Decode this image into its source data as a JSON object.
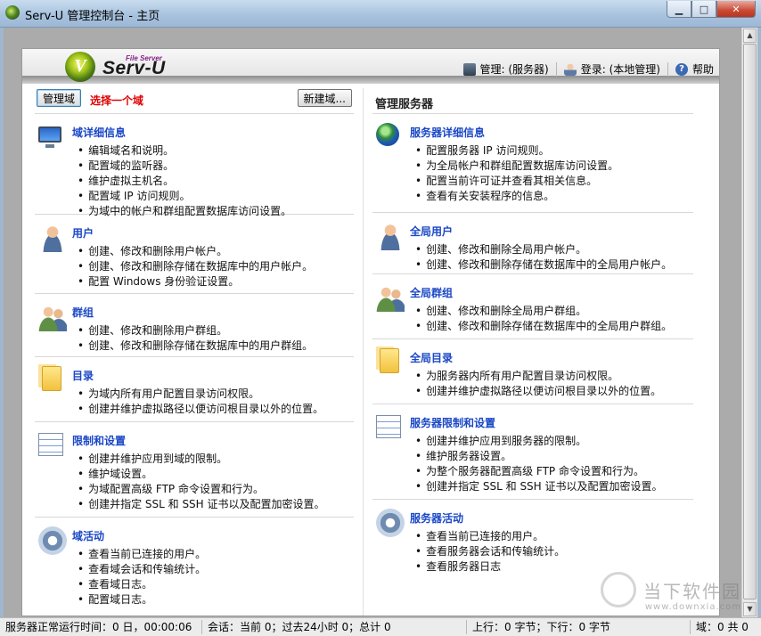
{
  "window": {
    "title": "Serv-U 管理控制台 - 主页",
    "buttons": {
      "minimize": "▁",
      "maximize": "□",
      "close": "✕"
    }
  },
  "banner": {
    "logo_text": "Serv-U",
    "logo_subtitle": "File Server",
    "logo_mark": "V",
    "links": {
      "manage": "管理: (服务器)",
      "login": "登录: (本地管理)",
      "help": "帮助"
    },
    "icons": [
      "server-icon",
      "user-icon",
      "help-icon"
    ]
  },
  "left": {
    "domain_button": "管理域",
    "select_hint": "选择一个域",
    "new_domain_button": "新建域...",
    "sections": [
      {
        "icon": "monitor-icon",
        "title": "域详细信息",
        "items": [
          "编辑域名和说明。",
          "配置域的监听器。",
          "维护虚拟主机名。",
          "配置域 IP 访问规则。",
          "为域中的帐户和群组配置数据库访问设置。"
        ]
      },
      {
        "icon": "user-icon",
        "title": "用户",
        "items": [
          "创建、修改和删除用户帐户。",
          "创建、修改和删除存储在数据库中的用户帐户。",
          "配置 Windows 身份验证设置。"
        ]
      },
      {
        "icon": "group-icon",
        "title": "群组",
        "items": [
          "创建、修改和删除用户群组。",
          "创建、修改和删除存储在数据库中的用户群组。"
        ]
      },
      {
        "icon": "folder-icon",
        "title": "目录",
        "items": [
          "为域内所有用户配置目录访问权限。",
          "创建并维护虚拟路径以便访问根目录以外的位置。"
        ]
      },
      {
        "icon": "checklist-icon",
        "title": "限制和设置",
        "items": [
          "创建并维护应用到域的限制。",
          "维护域设置。",
          "为域配置高级 FTP 命令设置和行为。",
          "创建并指定 SSL 和 SSH 证书以及配置加密设置。"
        ]
      },
      {
        "icon": "gear-icon",
        "title": "域活动",
        "items": [
          "查看当前已连接的用户。",
          "查看域会话和传输统计。",
          "查看域日志。",
          "配置域日志。"
        ]
      }
    ]
  },
  "right": {
    "heading": "管理服务器",
    "sections": [
      {
        "icon": "globe-icon",
        "title": "服务器详细信息",
        "items": [
          "配置服务器 IP 访问规则。",
          "为全局帐户和群组配置数据库访问设置。",
          "配置当前许可证并查看其相关信息。",
          "查看有关安装程序的信息。"
        ]
      },
      {
        "icon": "user-icon",
        "title": "全局用户",
        "items": [
          "创建、修改和删除全局用户帐户。",
          "创建、修改和删除存储在数据库中的全局用户帐户。"
        ]
      },
      {
        "icon": "group-icon",
        "title": "全局群组",
        "items": [
          "创建、修改和删除全局用户群组。",
          "创建、修改和删除存储在数据库中的全局用户群组。"
        ]
      },
      {
        "icon": "folder-icon",
        "title": "全局目录",
        "items": [
          "为服务器内所有用户配置目录访问权限。",
          "创建并维护虚拟路径以便访问根目录以外的位置。"
        ]
      },
      {
        "icon": "checklist-icon",
        "title": "服务器限制和设置",
        "items": [
          "创建并维护应用到服务器的限制。",
          "维护服务器设置。",
          "为整个服务器配置高级 FTP 命令设置和行为。",
          "创建并指定 SSL 和 SSH 证书以及配置加密设置。"
        ]
      },
      {
        "icon": "gear-icon",
        "title": "服务器活动",
        "items": [
          "查看当前已连接的用户。",
          "查看服务器会话和传输统计。",
          "查看服务器日志"
        ]
      }
    ]
  },
  "statusbar": {
    "uptime": "服务器正常运行时间：0 日，00:00:06",
    "sessions": "会话：当前 0；过去24小时 0；总计 0",
    "transfer": "上行：0 字节；下行：0 字节",
    "domains": "域：0 共 0"
  },
  "watermark": {
    "text": "当下软件园",
    "url": "www.downxia.com"
  }
}
